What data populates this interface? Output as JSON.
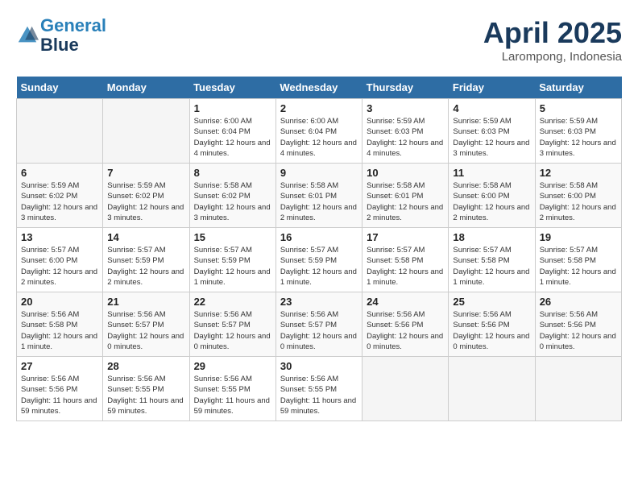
{
  "header": {
    "logo_line1": "General",
    "logo_line2": "Blue",
    "month": "April 2025",
    "location": "Larompong, Indonesia"
  },
  "days_of_week": [
    "Sunday",
    "Monday",
    "Tuesday",
    "Wednesday",
    "Thursday",
    "Friday",
    "Saturday"
  ],
  "weeks": [
    [
      {
        "num": "",
        "info": ""
      },
      {
        "num": "",
        "info": ""
      },
      {
        "num": "1",
        "info": "Sunrise: 6:00 AM\nSunset: 6:04 PM\nDaylight: 12 hours and 4 minutes."
      },
      {
        "num": "2",
        "info": "Sunrise: 6:00 AM\nSunset: 6:04 PM\nDaylight: 12 hours and 4 minutes."
      },
      {
        "num": "3",
        "info": "Sunrise: 5:59 AM\nSunset: 6:03 PM\nDaylight: 12 hours and 4 minutes."
      },
      {
        "num": "4",
        "info": "Sunrise: 5:59 AM\nSunset: 6:03 PM\nDaylight: 12 hours and 3 minutes."
      },
      {
        "num": "5",
        "info": "Sunrise: 5:59 AM\nSunset: 6:03 PM\nDaylight: 12 hours and 3 minutes."
      }
    ],
    [
      {
        "num": "6",
        "info": "Sunrise: 5:59 AM\nSunset: 6:02 PM\nDaylight: 12 hours and 3 minutes."
      },
      {
        "num": "7",
        "info": "Sunrise: 5:59 AM\nSunset: 6:02 PM\nDaylight: 12 hours and 3 minutes."
      },
      {
        "num": "8",
        "info": "Sunrise: 5:58 AM\nSunset: 6:02 PM\nDaylight: 12 hours and 3 minutes."
      },
      {
        "num": "9",
        "info": "Sunrise: 5:58 AM\nSunset: 6:01 PM\nDaylight: 12 hours and 2 minutes."
      },
      {
        "num": "10",
        "info": "Sunrise: 5:58 AM\nSunset: 6:01 PM\nDaylight: 12 hours and 2 minutes."
      },
      {
        "num": "11",
        "info": "Sunrise: 5:58 AM\nSunset: 6:00 PM\nDaylight: 12 hours and 2 minutes."
      },
      {
        "num": "12",
        "info": "Sunrise: 5:58 AM\nSunset: 6:00 PM\nDaylight: 12 hours and 2 minutes."
      }
    ],
    [
      {
        "num": "13",
        "info": "Sunrise: 5:57 AM\nSunset: 6:00 PM\nDaylight: 12 hours and 2 minutes."
      },
      {
        "num": "14",
        "info": "Sunrise: 5:57 AM\nSunset: 5:59 PM\nDaylight: 12 hours and 2 minutes."
      },
      {
        "num": "15",
        "info": "Sunrise: 5:57 AM\nSunset: 5:59 PM\nDaylight: 12 hours and 1 minute."
      },
      {
        "num": "16",
        "info": "Sunrise: 5:57 AM\nSunset: 5:59 PM\nDaylight: 12 hours and 1 minute."
      },
      {
        "num": "17",
        "info": "Sunrise: 5:57 AM\nSunset: 5:58 PM\nDaylight: 12 hours and 1 minute."
      },
      {
        "num": "18",
        "info": "Sunrise: 5:57 AM\nSunset: 5:58 PM\nDaylight: 12 hours and 1 minute."
      },
      {
        "num": "19",
        "info": "Sunrise: 5:57 AM\nSunset: 5:58 PM\nDaylight: 12 hours and 1 minute."
      }
    ],
    [
      {
        "num": "20",
        "info": "Sunrise: 5:56 AM\nSunset: 5:58 PM\nDaylight: 12 hours and 1 minute."
      },
      {
        "num": "21",
        "info": "Sunrise: 5:56 AM\nSunset: 5:57 PM\nDaylight: 12 hours and 0 minutes."
      },
      {
        "num": "22",
        "info": "Sunrise: 5:56 AM\nSunset: 5:57 PM\nDaylight: 12 hours and 0 minutes."
      },
      {
        "num": "23",
        "info": "Sunrise: 5:56 AM\nSunset: 5:57 PM\nDaylight: 12 hours and 0 minutes."
      },
      {
        "num": "24",
        "info": "Sunrise: 5:56 AM\nSunset: 5:56 PM\nDaylight: 12 hours and 0 minutes."
      },
      {
        "num": "25",
        "info": "Sunrise: 5:56 AM\nSunset: 5:56 PM\nDaylight: 12 hours and 0 minutes."
      },
      {
        "num": "26",
        "info": "Sunrise: 5:56 AM\nSunset: 5:56 PM\nDaylight: 12 hours and 0 minutes."
      }
    ],
    [
      {
        "num": "27",
        "info": "Sunrise: 5:56 AM\nSunset: 5:56 PM\nDaylight: 11 hours and 59 minutes."
      },
      {
        "num": "28",
        "info": "Sunrise: 5:56 AM\nSunset: 5:55 PM\nDaylight: 11 hours and 59 minutes."
      },
      {
        "num": "29",
        "info": "Sunrise: 5:56 AM\nSunset: 5:55 PM\nDaylight: 11 hours and 59 minutes."
      },
      {
        "num": "30",
        "info": "Sunrise: 5:56 AM\nSunset: 5:55 PM\nDaylight: 11 hours and 59 minutes."
      },
      {
        "num": "",
        "info": ""
      },
      {
        "num": "",
        "info": ""
      },
      {
        "num": "",
        "info": ""
      }
    ]
  ]
}
